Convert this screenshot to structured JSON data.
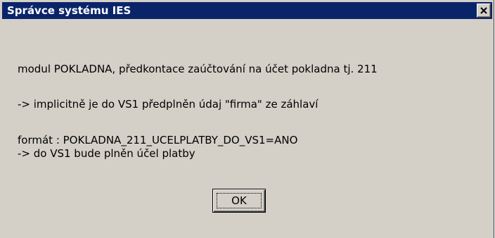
{
  "window": {
    "title": "Správce systému IES",
    "close_icon": "close-icon"
  },
  "message": {
    "line1": "modul POKLADNA, předkontace zaúčtování na účet pokladna tj. 211",
    "line2": "-> implicitně je do VS1 předplněn údaj \"firma\" ze záhlaví",
    "line3": "formát : POKLADNA_211_UCELPLATBY_DO_VS1=ANO",
    "line4": "-> do VS1 bude plněn účel platby"
  },
  "buttons": {
    "ok_label": "OK"
  },
  "colors": {
    "titlebar": "#0a246a",
    "dialog_bg": "#d4d0c8"
  }
}
